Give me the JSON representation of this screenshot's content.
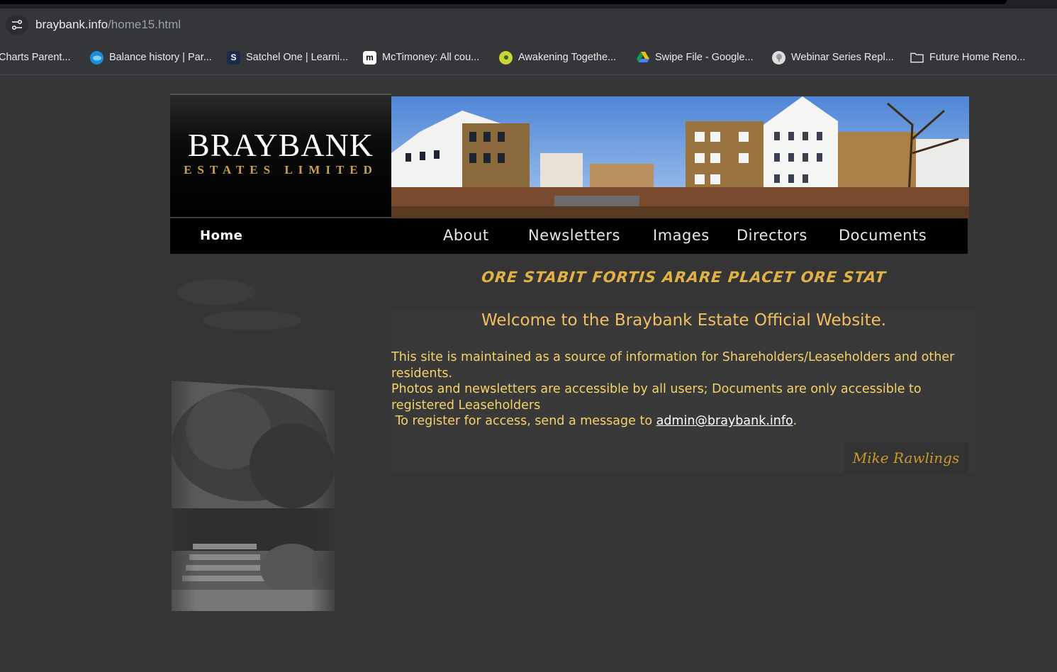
{
  "browser": {
    "url_host": "braybank.info",
    "url_path": "/home15.html",
    "bookmarks": [
      {
        "label": "Charts Parent...",
        "icon": "none"
      },
      {
        "label": "Balance history | Par...",
        "icon": "cloud-icon"
      },
      {
        "label": "Satchel One | Learni...",
        "icon": "satchel-icon"
      },
      {
        "label": "McTimoney: All cou...",
        "icon": "m-icon"
      },
      {
        "label": "Awakening Togethe...",
        "icon": "flower-icon"
      },
      {
        "label": "Swipe File - Google...",
        "icon": "google-drive-icon"
      },
      {
        "label": "Webinar Series Repl...",
        "icon": "tree-icon"
      },
      {
        "label": "Future Home Reno...",
        "icon": "folder-icon"
      }
    ]
  },
  "site": {
    "logo_name": "BRAYBANK",
    "logo_sub": "ESTATES LIMITED",
    "nav": {
      "home": "Home",
      "about": "About",
      "newsletters": "Newsletters",
      "images": "Images",
      "directors": "Directors",
      "documents": "Documents"
    },
    "motto": "ORE STABIT FORTIS ARARE PLACET ORE STAT",
    "welcome": "Welcome to the Braybank Estate Official Website.",
    "para1": "This site is maintained as a source of information for Shareholders/Leaseholders and other residents.",
    "para2": "Photos and newsletters are accessible by all users; Documents are only accessible to registered Leaseholders",
    "para3_prefix": " To register for access, send a message to ",
    "email": "admin@braybank.info",
    "para3_suffix": ".",
    "signature": "Mike Rawlings"
  },
  "colors": {
    "accent_gold": "#e2b244",
    "text_gold": "#f3d26a",
    "page_bg": "#353535"
  }
}
